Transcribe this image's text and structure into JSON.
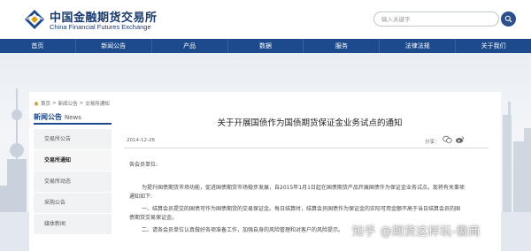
{
  "header": {
    "logo_cn": "中国金融期货交易所",
    "logo_en": "China Financial Futures Exchange",
    "search_placeholder": "输入关键字"
  },
  "nav": {
    "items": [
      "首页",
      "新闻公告",
      "产品",
      "数据",
      "服务",
      "法律法规",
      "关于我们"
    ]
  },
  "breadcrumb": {
    "items": [
      "首页",
      "新闻公告",
      "交易所通知"
    ]
  },
  "sidebar": {
    "title": "新闻公告",
    "title_en": "News",
    "items": [
      {
        "label": "交易所公告",
        "active": false
      },
      {
        "label": "交易所通知",
        "active": true
      },
      {
        "label": "交易所动态",
        "active": false
      },
      {
        "label": "采购公告",
        "active": false
      },
      {
        "label": "媒体新闻",
        "active": false
      }
    ]
  },
  "article": {
    "title": "关于开展国债作为国债期货保证金业务试点的通知",
    "date": "2014-12-26",
    "share_label": "分享：",
    "lines": [
      "各会员单位:",
      "为提升国债期货市场功能，促进国债期货市场稳步发展，自2015年1月1日起在国债期货产品开展国债作为保证金业务试点。现将有关事项",
      "通知如下:",
      "一、结算会员提交的国债可作为国债期货的交易保证金。每日结算时，结算会员国债作为保证金的实际可用金额不高于当日结算会员的国",
      "债期货交易保证金。",
      "二、请各会员单位认真做好各项准备工作，加强自身的风险管理和对客户的风险提示。"
    ]
  },
  "watermark": {
    "text": "知乎 @期货这样玩-徽商"
  },
  "colors": {
    "nav_bg": "#1d4a8c",
    "brand_text": "#1a3a6e"
  }
}
